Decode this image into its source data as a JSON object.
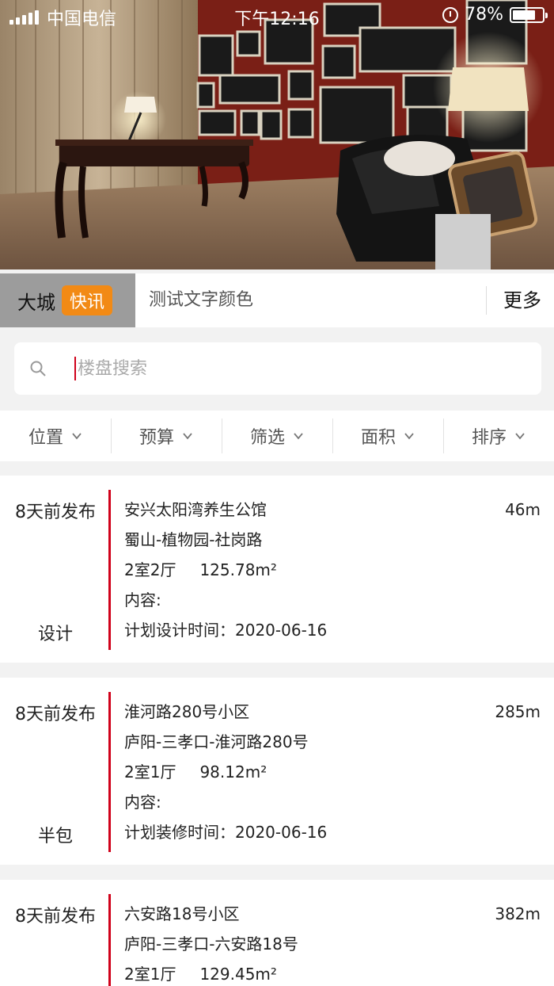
{
  "status_bar": {
    "carrier": "中国电信",
    "time": "下午12:16",
    "battery": "78%",
    "battery_level": 0.78
  },
  "ticker": {
    "city": "大城",
    "badge": "快讯",
    "headline": "测试文字颜色",
    "more": "更多"
  },
  "search": {
    "placeholder": "楼盘搜索"
  },
  "filters": [
    {
      "label": "位置"
    },
    {
      "label": "预算"
    },
    {
      "label": "筛选"
    },
    {
      "label": "面积"
    },
    {
      "label": "排序"
    }
  ],
  "listings": [
    {
      "posted": "8天前发布",
      "type": "设计",
      "name": "安兴太阳湾养生公馆",
      "location": "蜀山-植物园-社岗路",
      "rooms": "2室2厅",
      "area": "125.78m²",
      "content_label": "内容:",
      "plan": "计划设计时间：2020-06-16",
      "distance": "46m"
    },
    {
      "posted": "8天前发布",
      "type": "半包",
      "name": "淮河路280号小区",
      "location": "庐阳-三孝口-淮河路280号",
      "rooms": "2室1厅",
      "area": "98.12m²",
      "content_label": "内容:",
      "plan": "计划装修时间：2020-06-16",
      "distance": "285m"
    },
    {
      "posted": "8天前发布",
      "name": "六安路18号小区",
      "location": "庐阳-三孝口-六安路18号",
      "rooms": "2室1厅",
      "area": "129.45m²",
      "distance": "382m"
    }
  ],
  "colors": {
    "accent_red": "#d0021b",
    "badge_orange": "#f28a15",
    "tag_gray": "#9c9c9c"
  }
}
